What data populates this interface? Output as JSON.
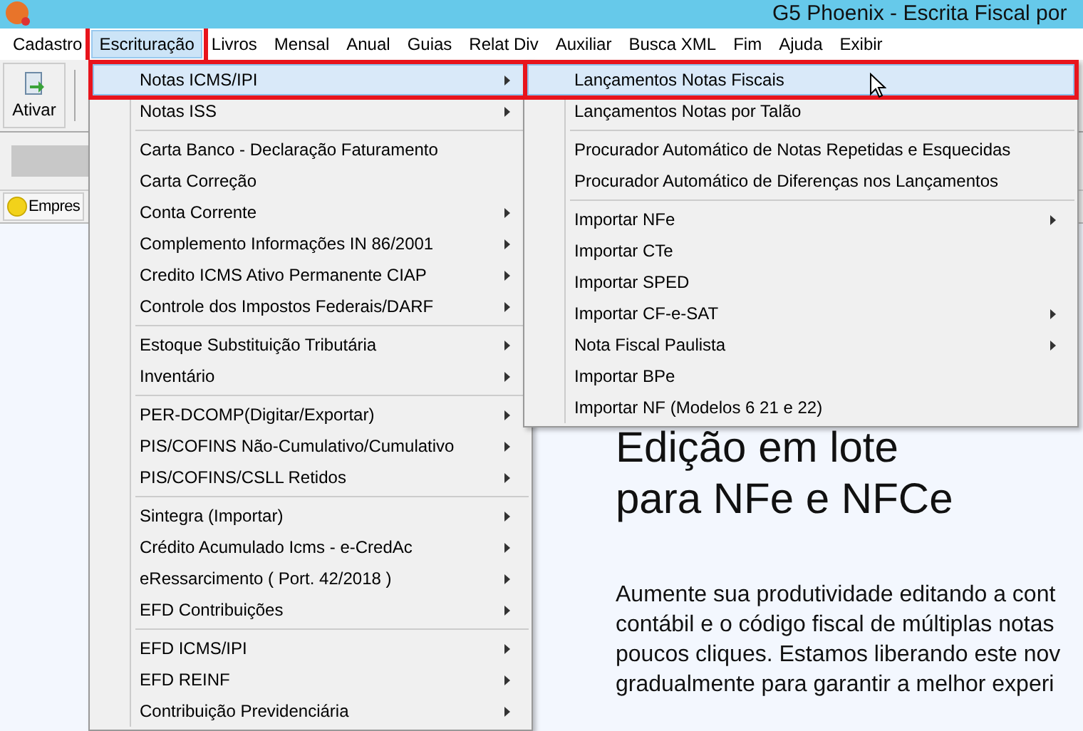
{
  "window": {
    "title": "G5 Phoenix - Escrita Fiscal por"
  },
  "menubar": [
    {
      "label": "Cadastro",
      "selected": false,
      "annotated": false
    },
    {
      "label": "Escrituração",
      "selected": true,
      "annotated": true
    },
    {
      "label": "Livros",
      "selected": false,
      "annotated": false
    },
    {
      "label": "Mensal",
      "selected": false,
      "annotated": false
    },
    {
      "label": "Anual",
      "selected": false,
      "annotated": false
    },
    {
      "label": "Guias",
      "selected": false,
      "annotated": false
    },
    {
      "label": "Relat Div",
      "selected": false,
      "annotated": false
    },
    {
      "label": "Auxiliar",
      "selected": false,
      "annotated": false
    },
    {
      "label": "Busca XML",
      "selected": false,
      "annotated": false
    },
    {
      "label": "Fim",
      "selected": false,
      "annotated": false
    },
    {
      "label": "Ajuda",
      "selected": false,
      "annotated": false
    },
    {
      "label": "Exibir",
      "selected": false,
      "annotated": false
    }
  ],
  "toolbar": {
    "buttons": [
      {
        "label": "Ativar"
      }
    ]
  },
  "tabs": [
    {
      "label": "Empres"
    }
  ],
  "menu": {
    "sections": [
      {
        "items": [
          {
            "label": "Notas ICMS/IPI",
            "submenu": true,
            "selected": true,
            "annotated": true
          },
          {
            "label": "Notas ISS",
            "submenu": true,
            "selected": false,
            "annotated": false
          }
        ]
      },
      {
        "items": [
          {
            "label": "Carta Banco - Declaração Faturamento",
            "submenu": false,
            "selected": false,
            "annotated": false
          },
          {
            "label": "Carta Correção",
            "submenu": false,
            "selected": false,
            "annotated": false
          },
          {
            "label": "Conta Corrente",
            "submenu": true,
            "selected": false,
            "annotated": false
          },
          {
            "label": "Complemento Informações IN 86/2001",
            "submenu": true,
            "selected": false,
            "annotated": false
          },
          {
            "label": "Credito ICMS Ativo Permanente CIAP",
            "submenu": true,
            "selected": false,
            "annotated": false
          },
          {
            "label": "Controle dos Impostos Federais/DARF",
            "submenu": true,
            "selected": false,
            "annotated": false
          }
        ]
      },
      {
        "items": [
          {
            "label": "Estoque Substituição Tributária",
            "submenu": true,
            "selected": false,
            "annotated": false
          },
          {
            "label": "Inventário",
            "submenu": true,
            "selected": false,
            "annotated": false
          }
        ]
      },
      {
        "items": [
          {
            "label": "PER-DCOMP(Digitar/Exportar)",
            "submenu": true,
            "selected": false,
            "annotated": false
          },
          {
            "label": "PIS/COFINS Não-Cumulativo/Cumulativo",
            "submenu": true,
            "selected": false,
            "annotated": false
          },
          {
            "label": "PIS/COFINS/CSLL Retidos",
            "submenu": true,
            "selected": false,
            "annotated": false
          }
        ]
      },
      {
        "items": [
          {
            "label": "Sintegra (Importar)",
            "submenu": true,
            "selected": false,
            "annotated": false
          },
          {
            "label": "Crédito Acumulado Icms - e-CredAc",
            "submenu": true,
            "selected": false,
            "annotated": false
          },
          {
            "label": "eRessarcimento ( Port. 42/2018 )",
            "submenu": true,
            "selected": false,
            "annotated": false
          },
          {
            "label": "EFD Contribuições",
            "submenu": true,
            "selected": false,
            "annotated": false
          }
        ]
      },
      {
        "items": [
          {
            "label": "EFD ICMS/IPI",
            "submenu": true,
            "selected": false,
            "annotated": false
          },
          {
            "label": "EFD REINF",
            "submenu": true,
            "selected": false,
            "annotated": false
          },
          {
            "label": "Contribuição Previdenciária",
            "submenu": true,
            "selected": false,
            "annotated": false
          }
        ]
      }
    ]
  },
  "submenu": {
    "sections": [
      {
        "items": [
          {
            "label": "Lançamentos Notas Fiscais",
            "submenu": false,
            "selected": true,
            "annotated": true
          },
          {
            "label": "Lançamentos Notas por Talão",
            "submenu": false,
            "selected": false,
            "annotated": false
          }
        ]
      },
      {
        "items": [
          {
            "label": "Procurador Automático de Notas Repetidas e Esquecidas",
            "submenu": false,
            "selected": false,
            "annotated": false
          },
          {
            "label": "Procurador Automático de Diferenças nos Lançamentos",
            "submenu": false,
            "selected": false,
            "annotated": false
          }
        ]
      },
      {
        "items": [
          {
            "label": "Importar NFe",
            "submenu": true,
            "selected": false,
            "annotated": false
          },
          {
            "label": "Importar CTe",
            "submenu": false,
            "selected": false,
            "annotated": false
          },
          {
            "label": "Importar SPED",
            "submenu": false,
            "selected": false,
            "annotated": false
          },
          {
            "label": "Importar CF-e-SAT",
            "submenu": true,
            "selected": false,
            "annotated": false
          },
          {
            "label": "Nota Fiscal Paulista",
            "submenu": true,
            "selected": false,
            "annotated": false
          },
          {
            "label": "Importar BPe",
            "submenu": false,
            "selected": false,
            "annotated": false
          },
          {
            "label": "Importar NF (Modelos 6 21 e 22)",
            "submenu": false,
            "selected": false,
            "annotated": false
          }
        ]
      }
    ]
  },
  "content": {
    "headline": [
      "Edição em lote",
      "para NFe e NFCe"
    ],
    "body": [
      "Aumente sua produtividade editando a cont",
      "contábil e o código fiscal de múltiplas notas",
      "poucos cliques. Estamos liberando este nov",
      "gradualmente para garantir a melhor experi"
    ]
  }
}
